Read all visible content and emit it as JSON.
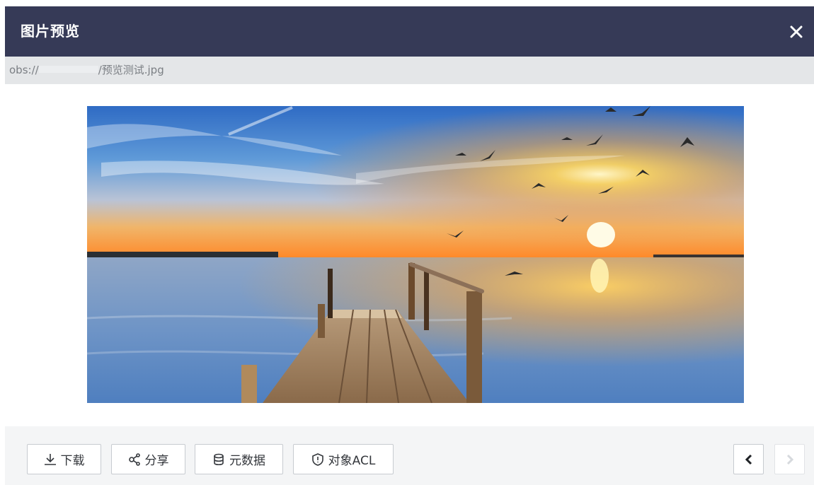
{
  "dialog": {
    "title": "图片预览",
    "close_icon": "close-icon"
  },
  "path": {
    "prefix": "obs://",
    "suffix": "/预览测试.jpg"
  },
  "image": {
    "subject": "sunset-pier-photo"
  },
  "toolbar": {
    "download_label": "下载",
    "share_label": "分享",
    "metadata_label": "元数据",
    "acl_label": "对象ACL",
    "prev_icon": "chevron-left-icon",
    "next_icon": "chevron-right-icon"
  },
  "colors": {
    "header_bg": "#363a57",
    "path_bg": "#e4e6e8",
    "footer_bg": "#f4f5f6"
  }
}
